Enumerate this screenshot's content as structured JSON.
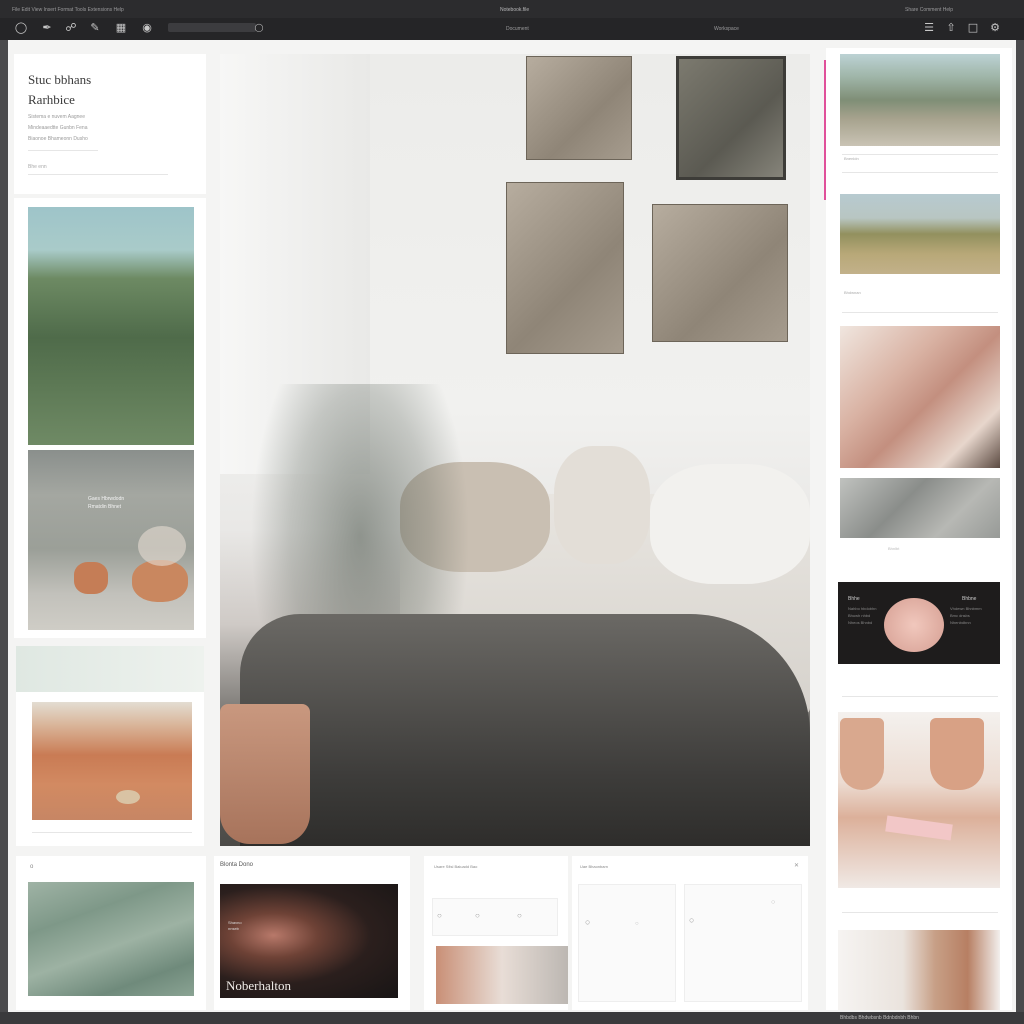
{
  "window": {
    "title": "Notebook.file",
    "tabs": [
      "Document",
      "Workspace"
    ],
    "menu_row": "File  Edit  View  Insert  Format  Tools  Extensions  Help",
    "right_controls": "Share  Comment  Help"
  },
  "toolbar": {
    "icons": [
      "circle-icon",
      "pen-icon",
      "link-icon",
      "paint-icon",
      "grid-icon",
      "eye-icon"
    ],
    "right_icons": [
      "menu-icon",
      "share-icon",
      "comment-icon",
      "settings-icon"
    ]
  },
  "left_panel": {
    "heading_1": "Stuc bbhans",
    "heading_2": "Rarhbice",
    "meta_lines": [
      "Sistema e nuvem Aagnee",
      "Mindeaaedtte Gunbn Fena",
      "Biaonoe Bhameonn Dusho"
    ],
    "field_label": "Bhe enn",
    "caption_card": [
      "Gaes Hbrwdodn",
      "Rmatdin Bhnet"
    ]
  },
  "left_lower": {
    "small_label": "o",
    "card_title": "Blonta Dono"
  },
  "bottom_cards": {
    "album_title": "Noberhalton",
    "album_sub": [
      "Shavno",
      "nnseb"
    ],
    "gallery_header_1": "Usare Sfisl Baiuadd Bao",
    "gallery_header_2": "Uae Bhaonbarn"
  },
  "right_column": {
    "labels": [
      "Bnenldn",
      "Bhdwnan",
      "Bhnlbt"
    ],
    "product_card": {
      "left_title": "Bhhe",
      "left_lines": [
        "Nahbo hbdobhn",
        "Bhuwh nhbd",
        "Nheos Bhnbd"
      ],
      "right_title": "Bhbne",
      "right_lines": [
        "Vhdewn Bhnbmm",
        "Bmc dnsbs",
        "Nhenbdbnn"
      ]
    }
  },
  "footer": {
    "status": "Bhbdbs  Bhdwbsnb  Bdnbdnbh  Bhbn"
  },
  "colors": {
    "background": "#4a4a4c",
    "topbar": "#252527",
    "canvas": "#f4f4f3",
    "accent": "#e0509a"
  }
}
